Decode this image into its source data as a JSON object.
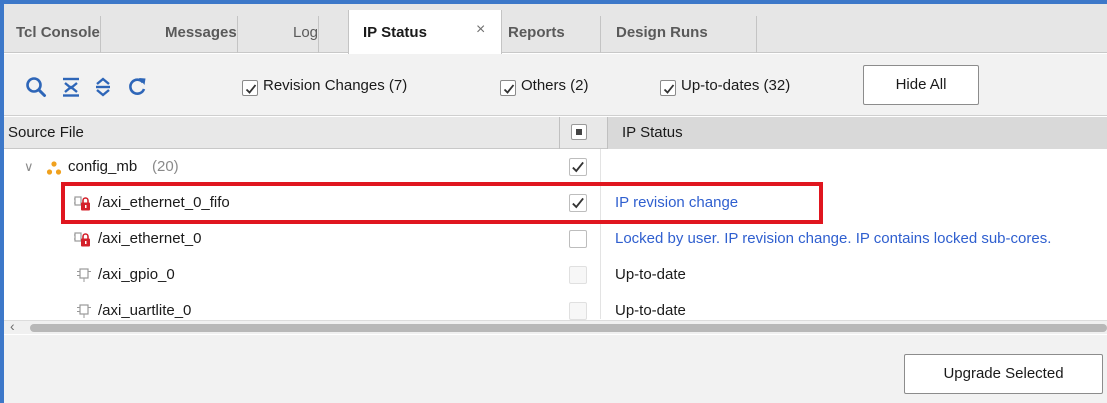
{
  "tabs": [
    {
      "label": "Tcl Console"
    },
    {
      "label": "Messages"
    },
    {
      "label": "Log"
    },
    {
      "label": "IP Status"
    },
    {
      "label": "Reports"
    },
    {
      "label": "Design Runs"
    }
  ],
  "tab_close_glyph": "×",
  "toolbar": {
    "icons": [
      "search-icon",
      "collapse-all-icon",
      "expand-all-icon",
      "refresh-icon"
    ],
    "filters": [
      {
        "label": "Revision Changes (7)",
        "checked": true
      },
      {
        "label": "Others (2)",
        "checked": true
      },
      {
        "label": "Up-to-dates (32)",
        "checked": true
      }
    ],
    "hide_all_label": "Hide All"
  },
  "table": {
    "columns": {
      "source_file": "Source File",
      "ip_status": "IP Status"
    },
    "rows": [
      {
        "name": "config_mb",
        "count": "(20)",
        "status": "",
        "checked": true,
        "type": "group"
      },
      {
        "name": "/axi_ethernet_0_fifo",
        "status": "IP revision change",
        "checked": true,
        "type": "locked",
        "link": true
      },
      {
        "name": "/axi_ethernet_0",
        "status": "Locked by user. IP revision change. IP contains locked sub-cores.",
        "checked": false,
        "type": "locked",
        "link": true
      },
      {
        "name": "/axi_gpio_0",
        "status": "Up-to-date",
        "checked": false,
        "type": "ip",
        "link": false
      },
      {
        "name": "/axi_uartlite_0",
        "status": "Up-to-date",
        "checked": false,
        "type": "ip",
        "link": false
      }
    ]
  },
  "footer": {
    "upgrade_label": "Upgrade Selected"
  },
  "colors": {
    "accent": "#3d78c9",
    "link": "#2f5fcf",
    "highlight": "#e0161f",
    "lock": "#d4202a"
  }
}
